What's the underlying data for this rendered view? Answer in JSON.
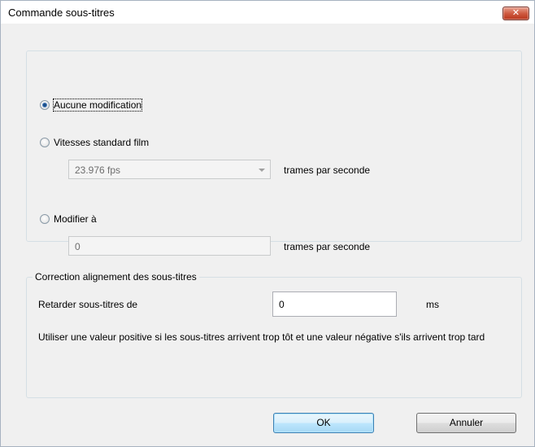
{
  "window": {
    "title": "Commande sous-titres",
    "close_glyph": "✕"
  },
  "framerate": {
    "option_none": "Aucune modification",
    "option_standard": "Vitesses standard film",
    "standard_value": "23.976 fps",
    "standard_unit": "trames par seconde",
    "option_custom": "Modifier à",
    "custom_value": "0",
    "custom_unit": "trames par seconde",
    "selected": "option_none"
  },
  "alignment": {
    "legend": "Correction alignement des sous-titres",
    "delay_label": "Retarder sous-titres de",
    "delay_value": "0",
    "delay_unit": "ms",
    "hint": "Utiliser une valeur positive si les sous-titres arrivent trop tôt et une valeur négative s'ils arrivent trop tard"
  },
  "buttons": {
    "ok": "OK",
    "cancel": "Annuler"
  }
}
